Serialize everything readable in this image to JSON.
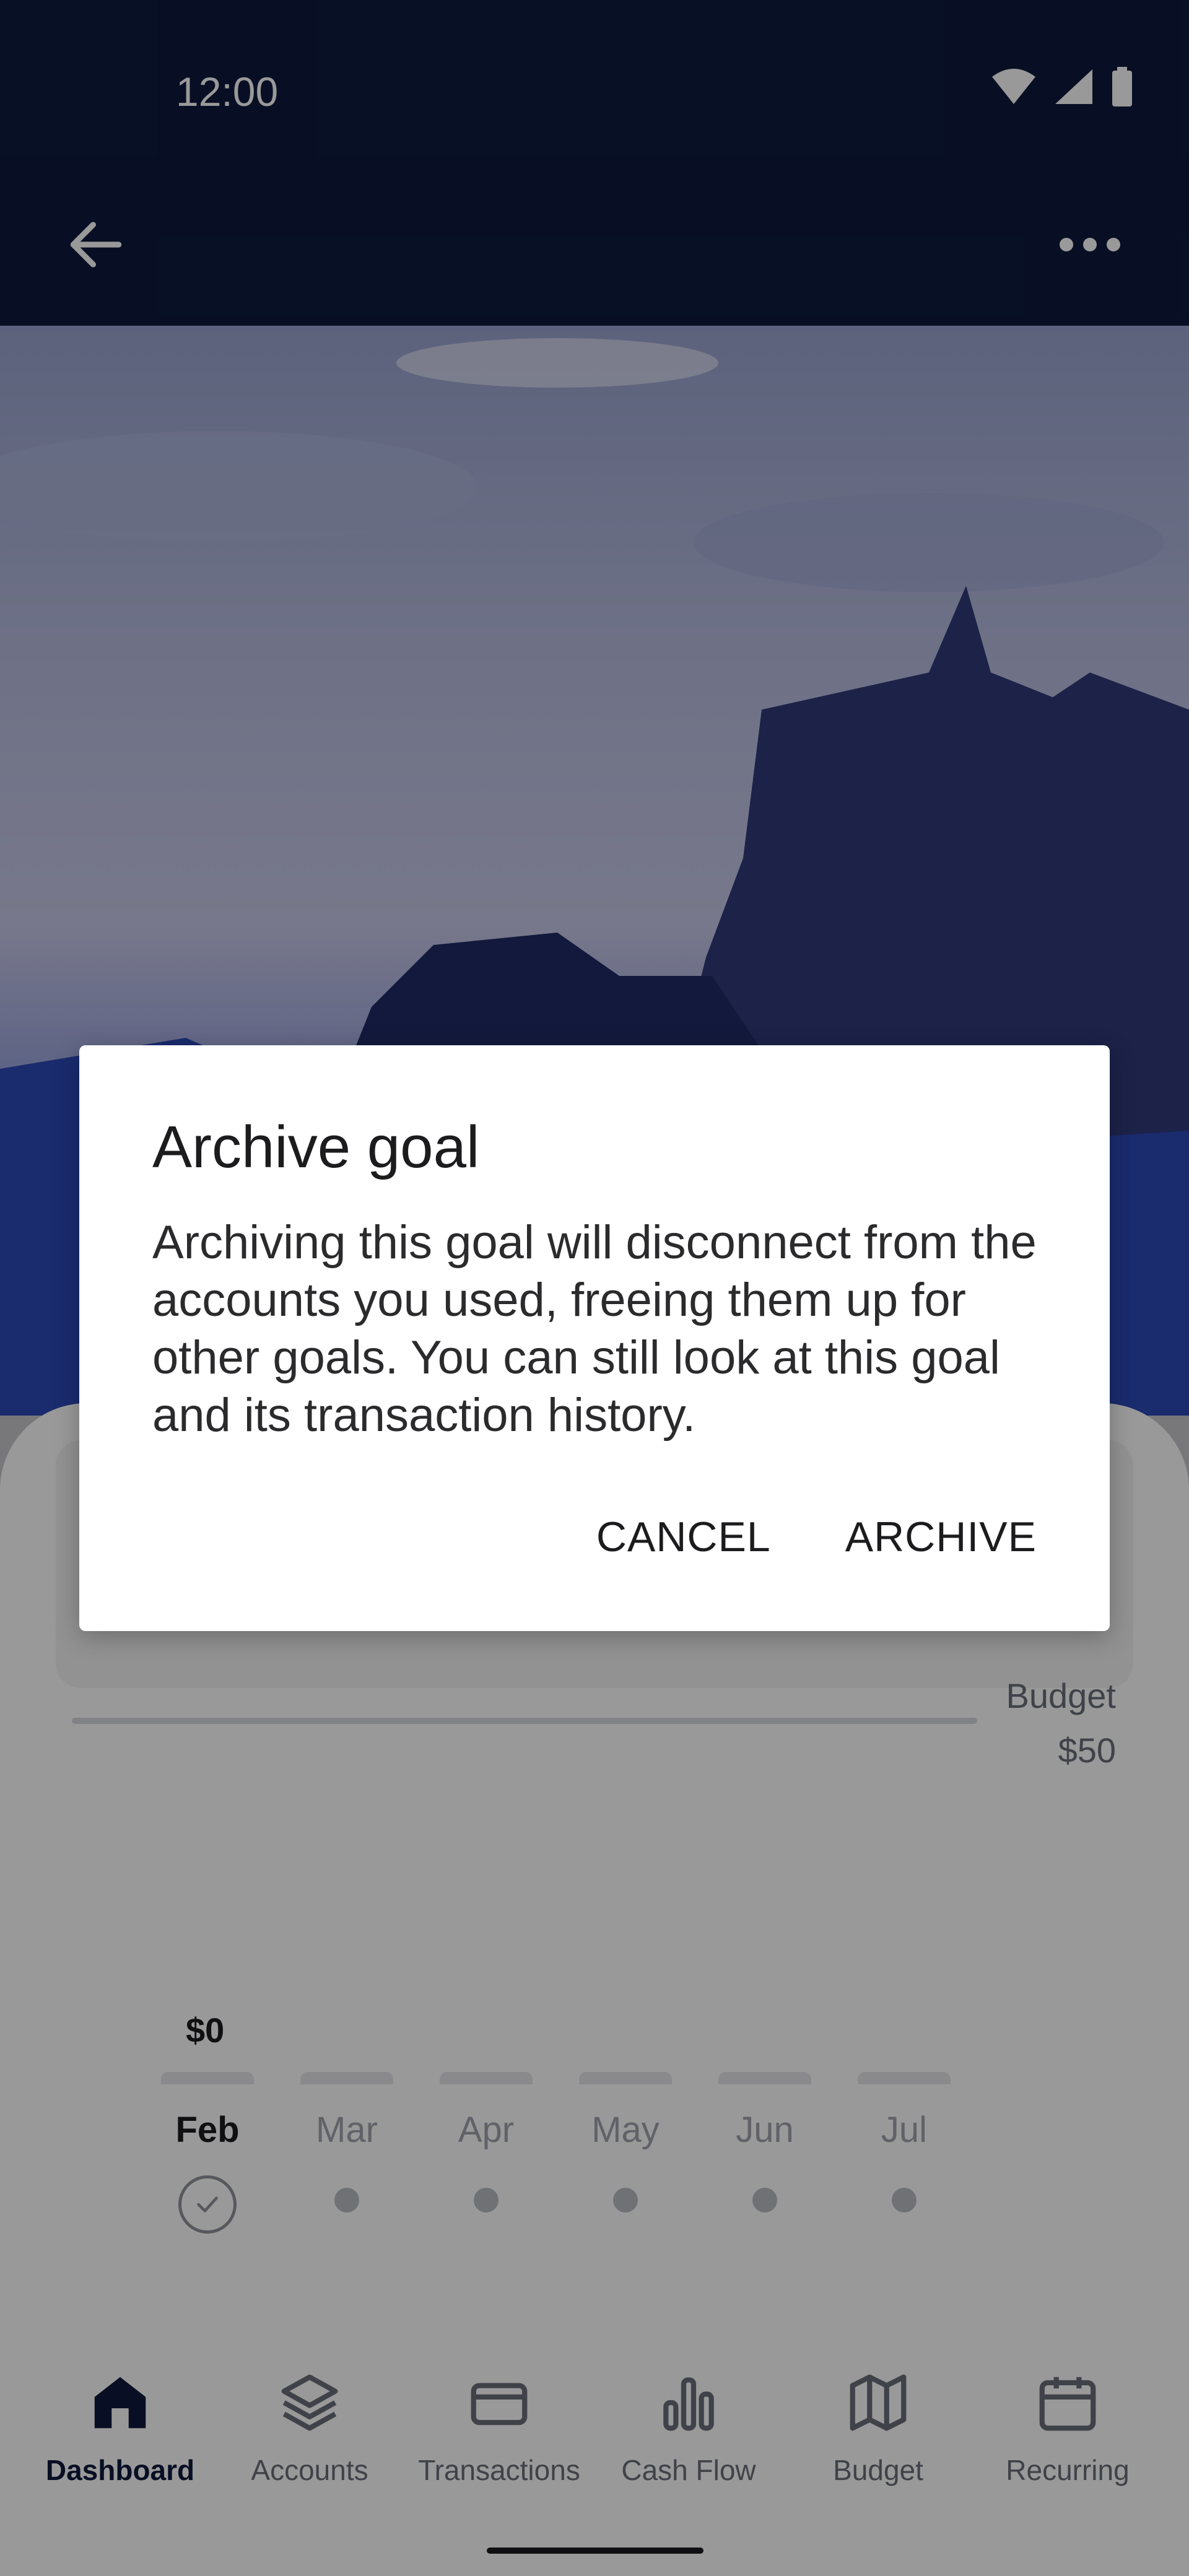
{
  "status_bar": {
    "time": "12:00",
    "icons": [
      "wifi-icon",
      "signal-icon",
      "battery-icon"
    ]
  },
  "app_bar": {
    "back_icon": "arrow-left-icon",
    "menu_icon": "more-horizontal-icon"
  },
  "budget": {
    "label": "Budget",
    "value": "$50"
  },
  "timeline": {
    "amount": "$0",
    "months": [
      "Feb",
      "Mar",
      "Apr",
      "May",
      "Jun",
      "Jul"
    ],
    "active_month": "Feb"
  },
  "bottom_nav": {
    "items": [
      {
        "label": "Dashboard",
        "icon": "home-icon"
      },
      {
        "label": "Accounts",
        "icon": "layers-icon"
      },
      {
        "label": "Transactions",
        "icon": "credit-card-icon"
      },
      {
        "label": "Cash Flow",
        "icon": "bar-chart-icon"
      },
      {
        "label": "Budget",
        "icon": "map-icon"
      },
      {
        "label": "Recurring",
        "icon": "calendar-icon"
      }
    ],
    "active": "Dashboard"
  },
  "dialog": {
    "title": "Archive goal",
    "body": "Archiving this goal will disconnect from the accounts you used, freeing them up for other goals. You can still look at this goal and its transaction history.",
    "cancel_label": "CANCEL",
    "confirm_label": "ARCHIVE"
  },
  "colors": {
    "header": "#0e1a3d",
    "accent": "#0e1a3d",
    "scrim": "rgba(0,0,0,0.40)"
  }
}
